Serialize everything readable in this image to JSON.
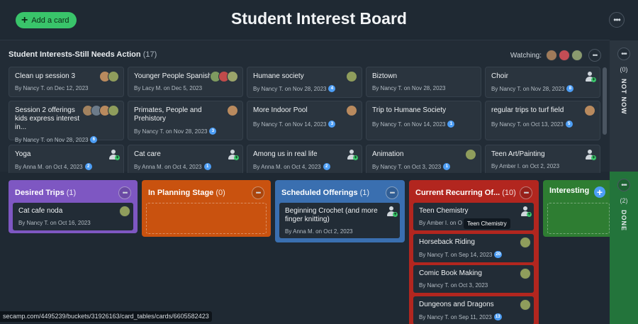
{
  "header": {
    "add_card_label": "Add a card",
    "title": "Student Interest Board",
    "more_label": "•••"
  },
  "triage": {
    "title": "Student Interests-Still Needs Action",
    "count": "(17)",
    "watching_label": "Watching:",
    "cards": [
      {
        "name": "Clean up session 3",
        "author": "By Nancy T. on Dec 12, 2023",
        "badge": ""
      },
      {
        "name": "Younger People Spanish",
        "author": "By Lacy M. on Dec 5, 2023",
        "badge": ""
      },
      {
        "name": "Humane society",
        "author": "By Nancy T. on Nov 28, 2023",
        "badge": "4"
      },
      {
        "name": "Biztown",
        "author": "By Nancy T. on Nov 28, 2023",
        "badge": ""
      },
      {
        "name": "Choir",
        "author": "By Nancy T. on Nov 28, 2023",
        "badge": "8"
      },
      {
        "name": "Session 2 offerings kids express interest in...",
        "author": "By Nancy T. on Nov 28, 2023",
        "badge": "6"
      },
      {
        "name": "Primates, People and Prehistory",
        "author": "By Nancy T. on Nov 28, 2023",
        "badge": "3"
      },
      {
        "name": "More Indoor Pool",
        "author": "By Nancy T. on Nov 14, 2023",
        "badge": "3"
      },
      {
        "name": "Trip to Humane Society",
        "author": "By Nancy T. on Nov 14, 2023",
        "badge": "1"
      },
      {
        "name": "regular trips to turf field",
        "author": "By Nancy T. on Oct 13, 2023",
        "badge": "5"
      },
      {
        "name": "Yoga",
        "author": "By Anna M. on Oct 4, 2023",
        "badge": "2"
      },
      {
        "name": "Cat care",
        "author": "By Anna M. on Oct 4, 2023",
        "badge": "1"
      },
      {
        "name": "Among us in real life",
        "author": "By Anna M. on Oct 4, 2023",
        "badge": "2"
      },
      {
        "name": "Animation",
        "author": "By Nancy T. on Oct 3, 2023",
        "badge": "1"
      },
      {
        "name": "Teen Art/Painting",
        "author": "By Amber I. on Oct 2, 2023",
        "badge": ""
      }
    ]
  },
  "not_now": {
    "count": "(0)",
    "label": "NOT NOW"
  },
  "done": {
    "count": "(2)",
    "label": "DONE"
  },
  "columns": {
    "desired_trips": {
      "title": "Desired Trips",
      "count": "(1)",
      "color": "#7e57c2",
      "cards": [
        {
          "name": "Cat cafe noda",
          "author": "By Nancy T. on Oct 16, 2023"
        }
      ]
    },
    "in_planning": {
      "title": "In Planning Stage",
      "count": "(0)",
      "color": "#c9520f"
    },
    "scheduled": {
      "title": "Scheduled Offerings",
      "count": "(1)",
      "color": "#3a6fb0",
      "cards": [
        {
          "name": "Beginning Crochet (and more finger knitting)",
          "author": "By Anna M. on Oct 2, 2023"
        }
      ]
    },
    "recurring": {
      "title": "Current Recurring Of...",
      "count": "(10)",
      "color": "#b2261f",
      "cards": [
        {
          "name": "Teen Chemistry",
          "author": "By Amber I. on O",
          "badge": ""
        },
        {
          "name": "Horseback Riding",
          "author": "By Nancy T. on Sep 14, 2023",
          "badge": "20"
        },
        {
          "name": "Comic Book Making",
          "author": "By Nancy T. on Oct 3, 2023",
          "badge": ""
        },
        {
          "name": "Dungeons and Dragons",
          "author": "By Nancy T. on Sep 11, 2023",
          "badge": "13"
        }
      ]
    },
    "interesting": {
      "title": "Interesting",
      "color": "#2e7d32"
    }
  },
  "tooltip": "Teen Chemistry",
  "status_url": "secamp.com/4495239/buckets/31926163/card_tables/cards/6605582423",
  "colors": {
    "green": "#39c46a",
    "blue_badge": "#4d9ef5",
    "done": "#23743b"
  }
}
